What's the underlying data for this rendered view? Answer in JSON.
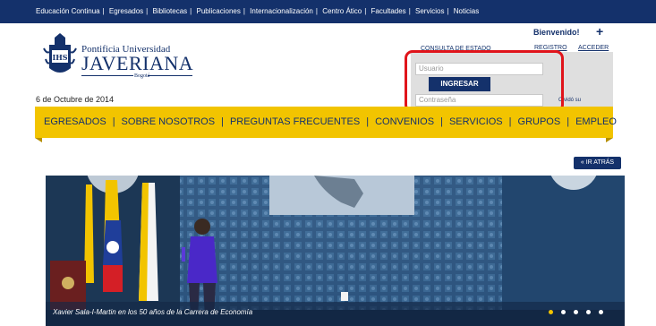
{
  "topnav": {
    "items": [
      "Educación Continua",
      "Egresados",
      "Bibliotecas",
      "Publicaciones",
      "Internacionalización",
      "Centro Ático",
      "Facultades",
      "Servicios",
      "Noticias"
    ]
  },
  "logo": {
    "line1": "Pontificia Universidad",
    "line2": "JAVERIANA",
    "line3": "Bogotá",
    "crest_letters": "IHS"
  },
  "date": "6 de Octubre de 2014",
  "account": {
    "welcome": "Bienvenido!",
    "plus": "+",
    "consulta_link": "CONSULTA DE ESTADO",
    "registro_link": "REGISTRO",
    "acceder_link": "ACCEDER",
    "user_placeholder": "Usuario",
    "login_button": "INGRESAR",
    "password_placeholder": "Contraseña",
    "forgot_link": "Olvidó su"
  },
  "menu": {
    "items": [
      "EGRESADOS",
      "SOBRE NOSOTROS",
      "PREGUNTAS FRECUENTES",
      "CONVENIOS",
      "SERVICIOS",
      "GRUPOS",
      "EMPLEO"
    ]
  },
  "back_button": "« IR ATRÁS",
  "carousel": {
    "caption": "Xavier Sala-I-Martin en los 50 años de la Carrera de Economía",
    "slide_count": 5,
    "active_index": 0
  },
  "colors": {
    "navy": "#14316b",
    "yellow": "#f2c400",
    "highlight_red": "#e0141b"
  }
}
